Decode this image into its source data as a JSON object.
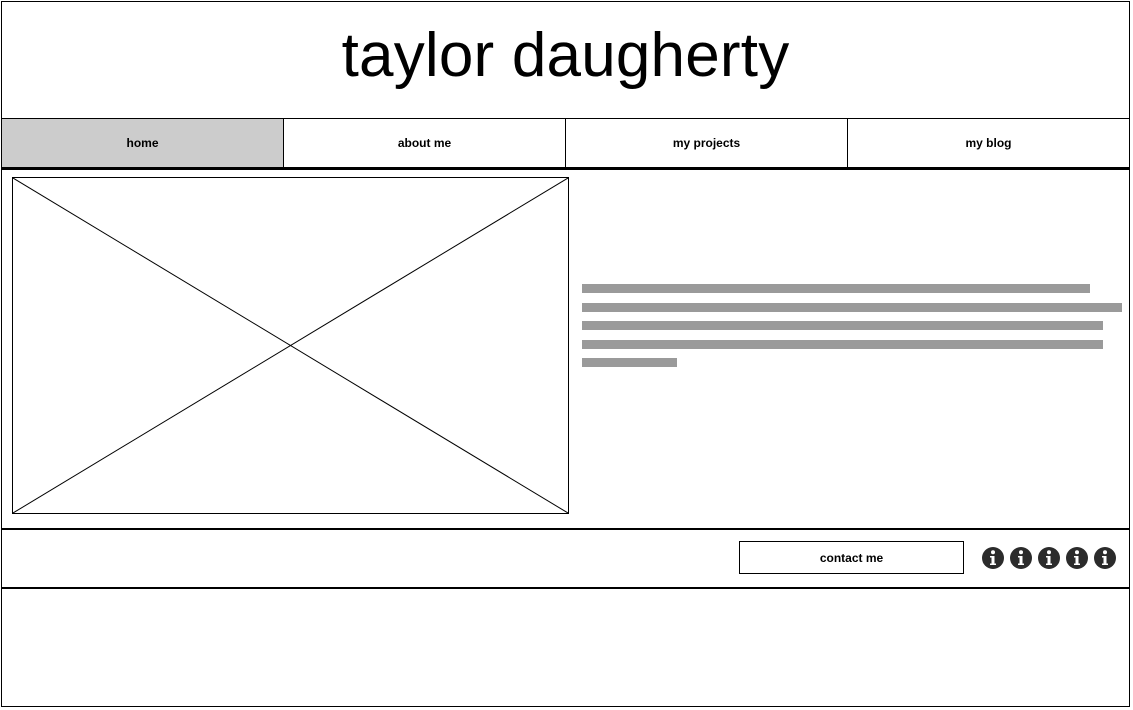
{
  "header": {
    "title": "taylor daugherty"
  },
  "nav": {
    "items": [
      {
        "label": "home",
        "active": true
      },
      {
        "label": "about me",
        "active": false
      },
      {
        "label": "my projects",
        "active": false
      },
      {
        "label": "my blog",
        "active": false
      }
    ],
    "active_color": "#cccccc"
  },
  "main": {
    "image_placeholder_icon": "image-placeholder-x",
    "text_placeholder_color": "#9a9a9a",
    "text_line_fill": [
      0.94,
      1.0,
      0.965,
      0.965,
      0.175
    ]
  },
  "footer": {
    "contact_label": "contact me",
    "social_icons": [
      "info-icon",
      "info-icon",
      "info-icon",
      "info-icon",
      "info-icon"
    ],
    "icon_color": "#2b2b2b"
  }
}
